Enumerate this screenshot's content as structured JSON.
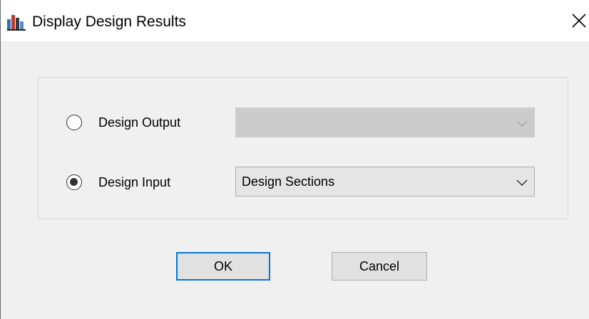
{
  "window": {
    "title": "Display Design Results",
    "app_icon": "etabs-app-icon",
    "close_icon": "close-icon"
  },
  "options": {
    "design_output": {
      "label": "Design Output",
      "selected": false,
      "combo_value": "",
      "combo_enabled": false
    },
    "design_input": {
      "label": "Design Input",
      "selected": true,
      "combo_value": "Design Sections",
      "combo_enabled": true
    }
  },
  "buttons": {
    "ok_label": "OK",
    "cancel_label": "Cancel"
  },
  "colors": {
    "dialog_bg": "#f0f0f0",
    "titlebar_bg": "#ffffff",
    "default_button_border": "#0078d7",
    "disabled_combo_bg": "#cccccc"
  }
}
